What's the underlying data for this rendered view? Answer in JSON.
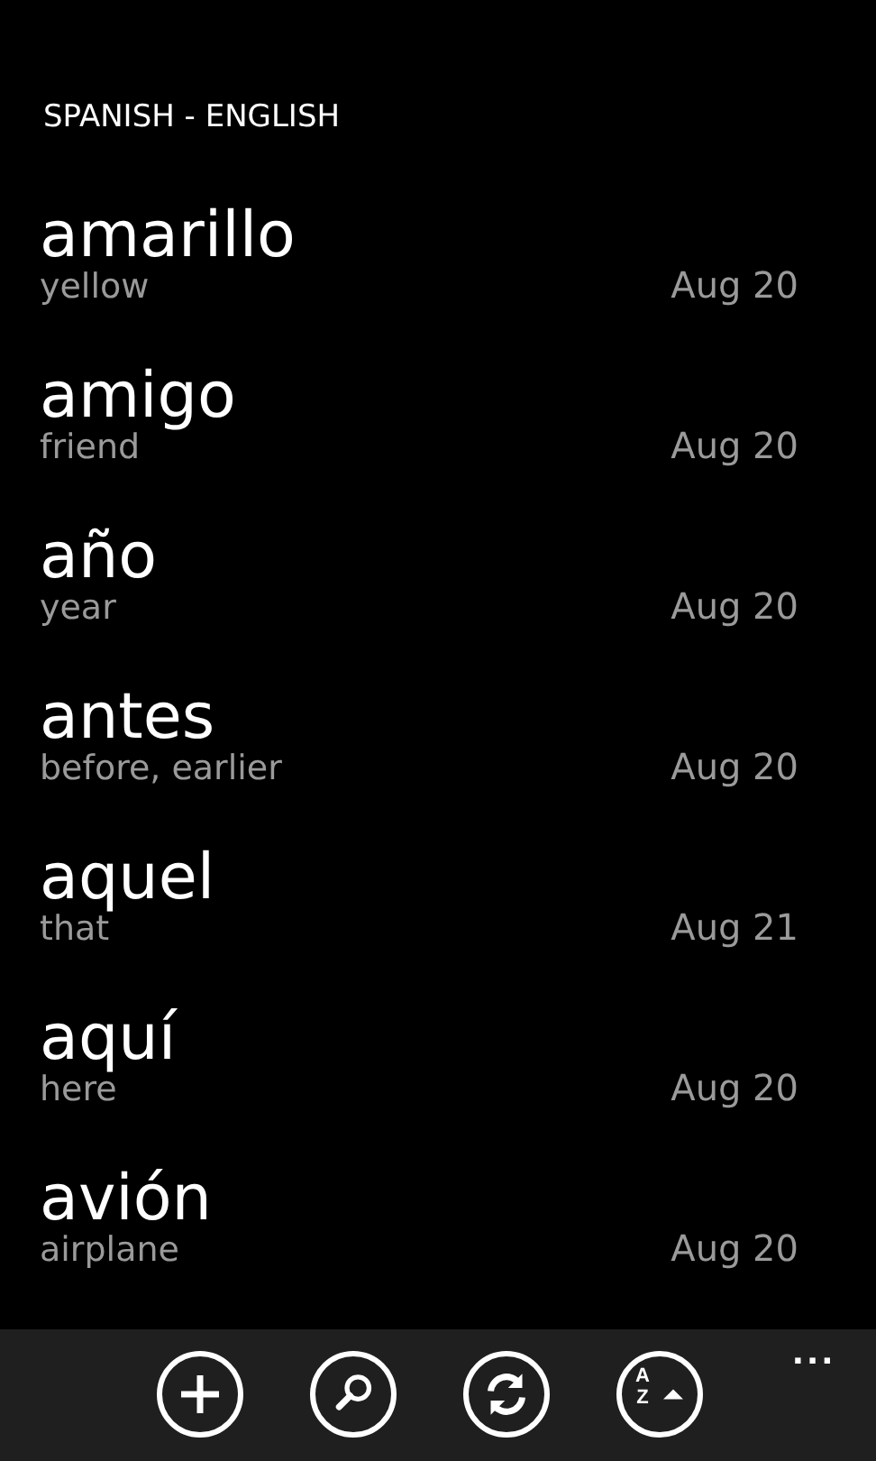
{
  "header": {
    "title": "SPANISH - ENGLISH"
  },
  "entries": [
    {
      "word": "amarillo",
      "translation": "yellow",
      "date": "Aug 20"
    },
    {
      "word": "amigo",
      "translation": "friend",
      "date": "Aug 20"
    },
    {
      "word": "año",
      "translation": "year",
      "date": "Aug 20"
    },
    {
      "word": "antes",
      "translation": "before, earlier",
      "date": "Aug 20"
    },
    {
      "word": "aquel",
      "translation": "that",
      "date": "Aug 21"
    },
    {
      "word": "aquí",
      "translation": "here",
      "date": "Aug 20"
    },
    {
      "word": "avión",
      "translation": "airplane",
      "date": "Aug 20"
    }
  ],
  "app_bar": {
    "buttons": [
      {
        "kind": "add"
      },
      {
        "kind": "search"
      },
      {
        "kind": "sync"
      },
      {
        "kind": "sort",
        "glyphs": [
          "A",
          "Z"
        ]
      }
    ],
    "more": "..."
  }
}
